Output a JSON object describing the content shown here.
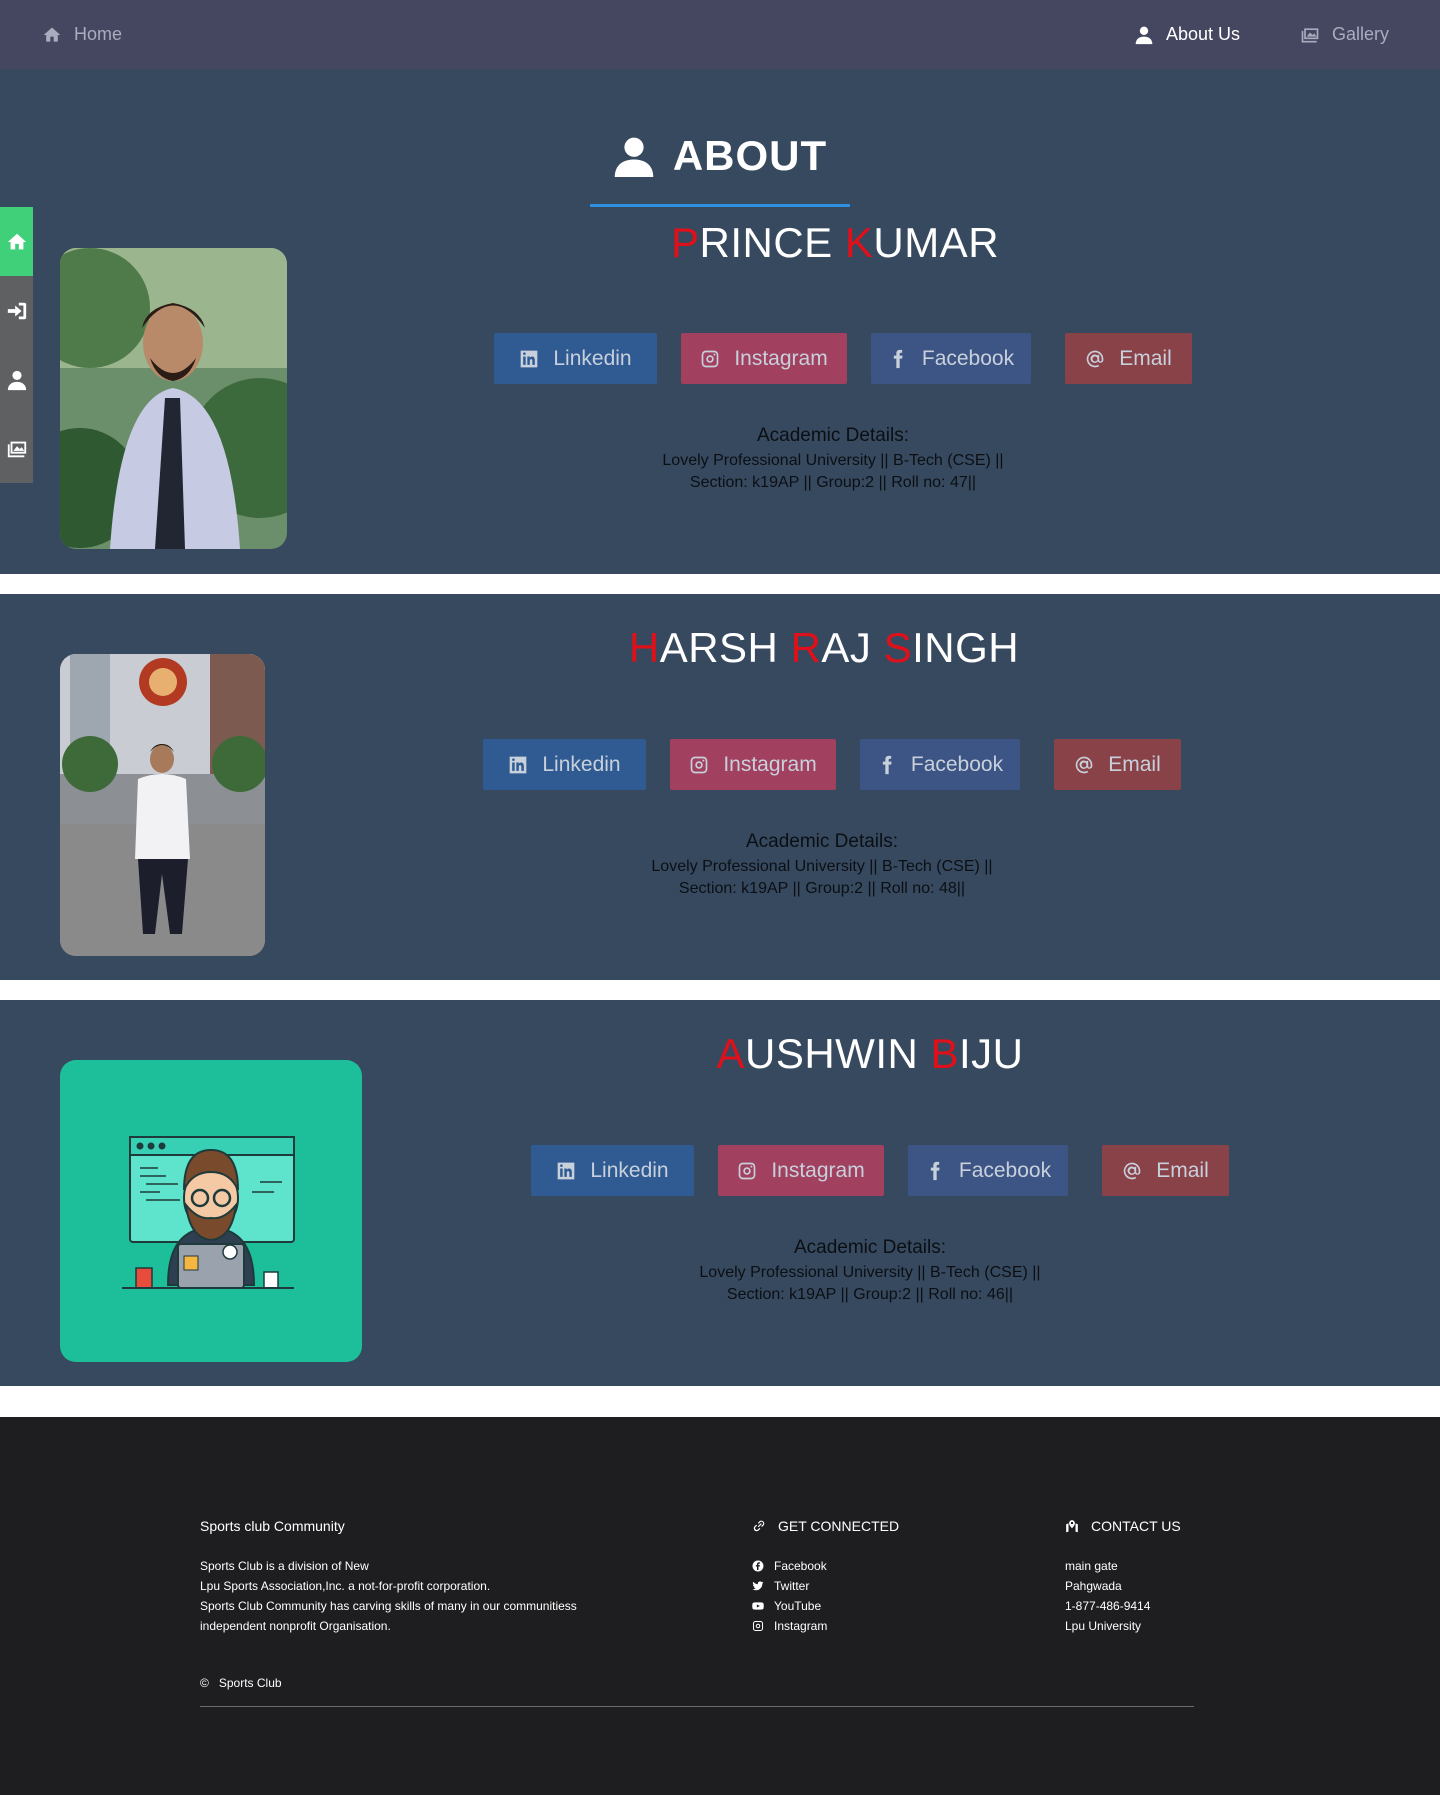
{
  "nav": {
    "home_label": "Home",
    "about_label": "About Us",
    "gallery_label": "Gallery",
    "icons": {
      "home": "home-icon",
      "about": "user-icon",
      "gallery": "gallery-icon"
    }
  },
  "sidebar": {
    "items": [
      {
        "name": "home",
        "icon": "home-icon",
        "active": true
      },
      {
        "name": "login",
        "icon": "sign-in-icon",
        "active": false
      },
      {
        "name": "about",
        "icon": "user-icon",
        "active": false
      },
      {
        "name": "gallery",
        "icon": "gallery-icon",
        "active": false
      }
    ]
  },
  "heading": {
    "title": "ABOUT",
    "icon": "user-icon"
  },
  "members": [
    {
      "name_parts": [
        {
          "initial": "P",
          "rest": "RINCE"
        },
        {
          "initial": "K",
          "rest": "UMAR"
        }
      ],
      "buttons": {
        "linkedin": "Linkedin",
        "instagram": "Instagram",
        "facebook": "Facebook",
        "email": "Email"
      },
      "academic_title": "Academic Details:",
      "academic_line1": "Lovely Professional University || B-Tech (CSE) ||",
      "academic_line2": "Section: k19AP || Group:2 || Roll no: 47||"
    },
    {
      "name_parts": [
        {
          "initial": "H",
          "rest": "ARSH"
        },
        {
          "initial": "R",
          "rest": "AJ"
        },
        {
          "initial": "S",
          "rest": "INGH"
        }
      ],
      "buttons": {
        "linkedin": "Linkedin",
        "instagram": "Instagram",
        "facebook": "Facebook",
        "email": "Email"
      },
      "academic_title": "Academic Details:",
      "academic_line1": "Lovely Professional University || B-Tech (CSE) ||",
      "academic_line2": "Section: k19AP || Group:2 || Roll no: 48||"
    },
    {
      "name_parts": [
        {
          "initial": "A",
          "rest": "USHWIN"
        },
        {
          "initial": "B",
          "rest": "IJU"
        }
      ],
      "buttons": {
        "linkedin": "Linkedin",
        "instagram": "Instagram",
        "facebook": "Facebook",
        "email": "Email"
      },
      "academic_title": "Academic Details:",
      "academic_line1": "Lovely Professional University || B-Tech (CSE) ||",
      "academic_line2": "Section: k19AP || Group:2 || Roll no: 46||"
    }
  ],
  "colors": {
    "nav_bg": "#454760",
    "section_bg": "#37495f",
    "name_initial": "#e0101a",
    "underline": "#2f8fe0",
    "sidebar_active": "#41d07a",
    "footer_bg": "#1e1e20"
  },
  "footer": {
    "brand_title": "Sports club Community",
    "brand_lines": [
      "Sports Club is a division of New",
      "Lpu Sports Association,Inc. a not-for-profit corporation.",
      "Sports Club Community has carving skills of many in our communitiess",
      "independent nonprofit Organisation."
    ],
    "connect_title": "GET CONNECTED",
    "connect_links": [
      "Facebook",
      "Twitter",
      "YouTube",
      "Instagram"
    ],
    "contact_title": "CONTACT US",
    "contact_lines": [
      "main gate",
      "Pahgwada",
      "1-877-486-9414",
      "Lpu University"
    ],
    "copyright": "Sports Club"
  }
}
